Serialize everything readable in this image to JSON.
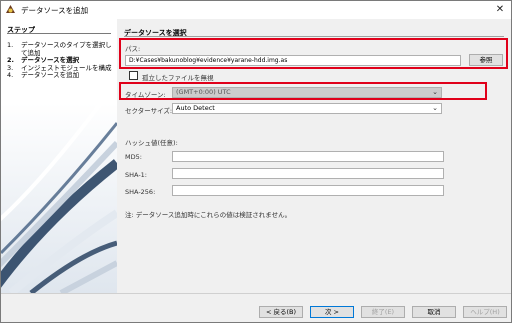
{
  "window": {
    "title": "データソースを追加",
    "close_glyph": "✕"
  },
  "sidebar": {
    "heading": "ステップ",
    "steps": [
      {
        "num": "1.",
        "label": "データソースのタイプを選択して追加"
      },
      {
        "num": "2.",
        "label": "データソースを選択"
      },
      {
        "num": "3.",
        "label": "インジェストモジュールを構成"
      },
      {
        "num": "4.",
        "label": "データソースを追加"
      }
    ]
  },
  "content": {
    "section_title": "データソースを選択",
    "path_label": "パス:",
    "path_value": "D:¥Cases¥bakunoblog¥evidence¥yarane-hdd.img.as",
    "browse_button": "参照",
    "ignore_orphans_label": "孤立したファイルを無視",
    "timezone_label": "タイムゾーン:",
    "timezone_value": "(GMT+0:00) UTC",
    "sector_label": "セクターサイズ:",
    "sector_value": "Auto Detect",
    "hash_heading": "ハッシュ値(任意):",
    "md5_label": "MD5:",
    "sha1_label": "SHA-1:",
    "sha256_label": "SHA-256:",
    "note": "注: データソース追加時にこれらの値は検証されません。"
  },
  "footer": {
    "back": "< 戻る(B)",
    "next": "次 >",
    "finish": "終了(E)",
    "cancel": "取消",
    "help": "ヘルプ(H)"
  },
  "colors": {
    "highlight": "#e0001a",
    "accent": "#0078d7"
  },
  "icons": {
    "app": "app-logo-icon",
    "close": "close-icon",
    "dropdown": "chevron-down-icon"
  }
}
